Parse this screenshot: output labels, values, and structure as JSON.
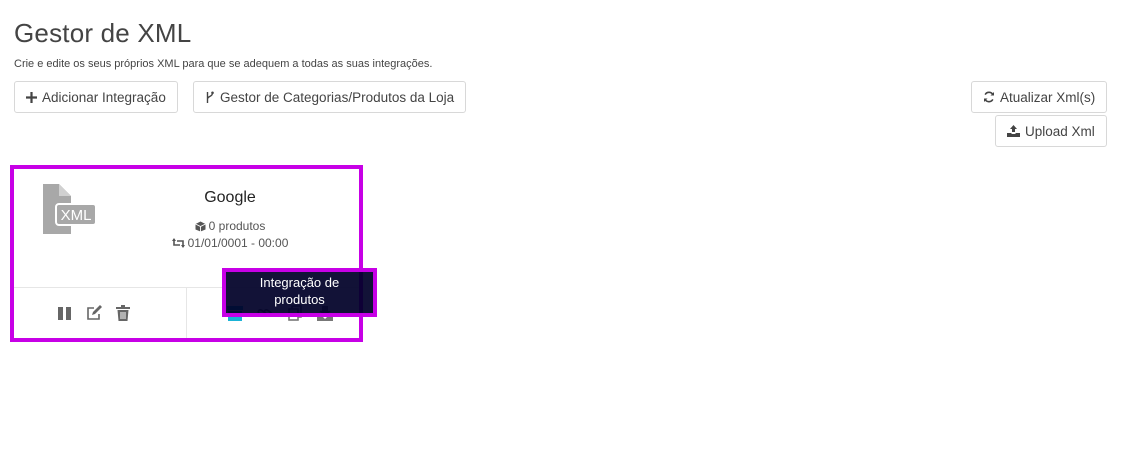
{
  "page": {
    "title": "Gestor de XML",
    "subtitle": "Crie e edite os seus próprios XML para que se adequem a todas as suas integrações."
  },
  "toolbar": {
    "add_label": "Adicionar Integração",
    "categories_label": "Gestor de Categorias/Produtos da Loja",
    "refresh_label": "Atualizar Xml(s)",
    "upload_label": "Upload Xml"
  },
  "card": {
    "icon_text": "XML",
    "name": "Google",
    "products": "0 produtos",
    "updated": "01/01/0001 - 00:00"
  },
  "tooltip": {
    "line1": "Integração de",
    "line2": "produtos"
  },
  "colors": {
    "highlight": "#c700e6",
    "accent": "#1ab3d6",
    "icon_gray": "#a8a8a8",
    "tooltip_bg": "#00002a"
  }
}
